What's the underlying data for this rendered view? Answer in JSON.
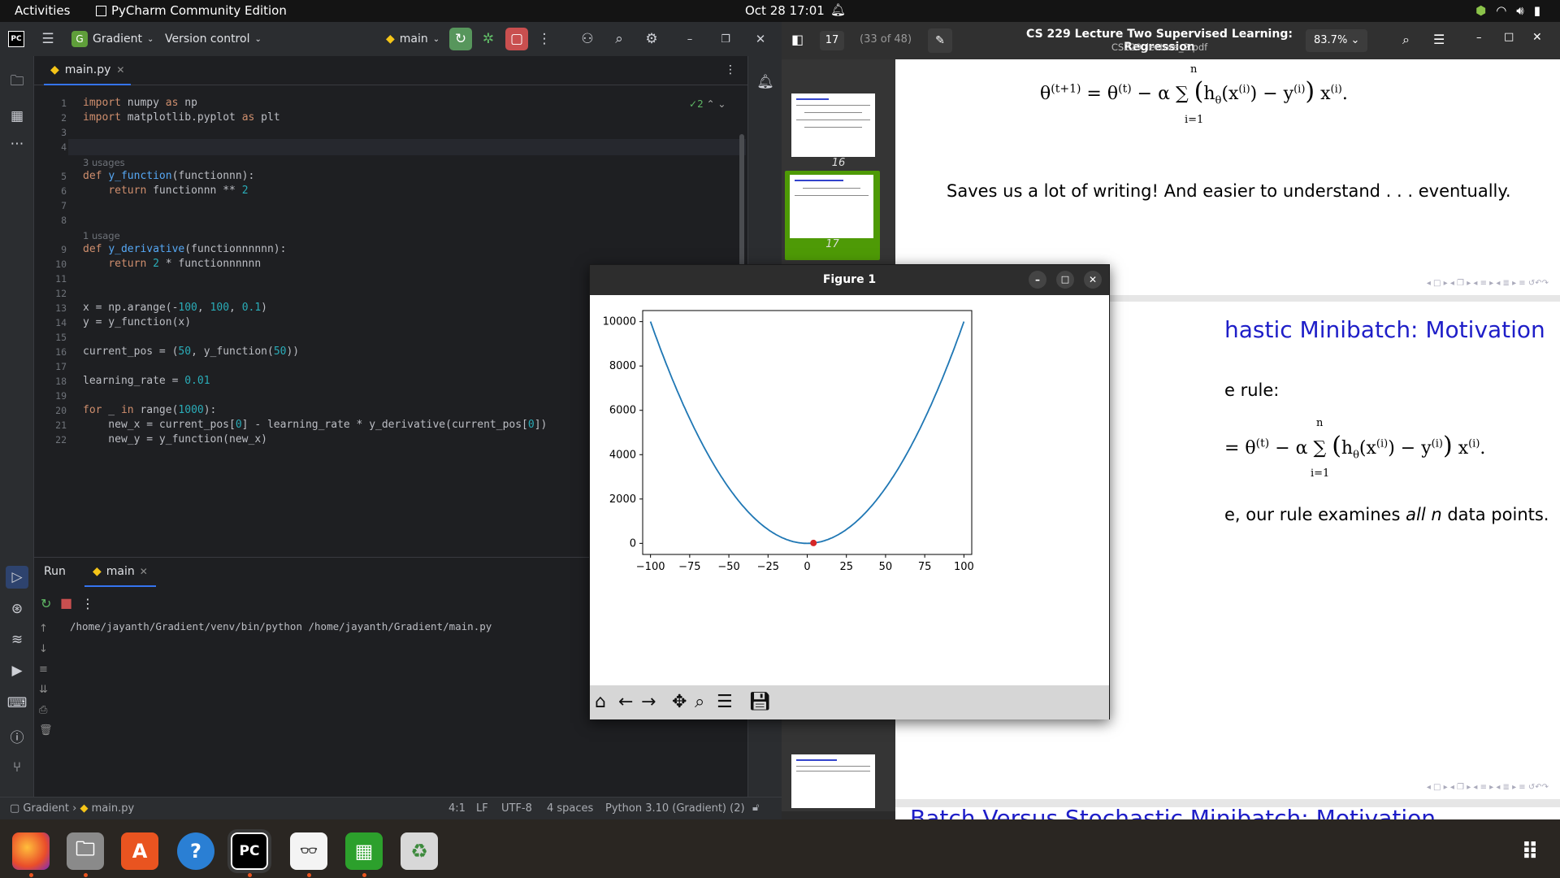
{
  "system": {
    "activities": "Activities",
    "app_name": "PyCharm Community Edition",
    "clock": "Oct 28  17:01"
  },
  "pycharm": {
    "project_initial": "G",
    "project": "Gradient",
    "vcs": "Version control",
    "branch": "main",
    "file_tab": "main.py",
    "inspections": "2",
    "code_lines": [
      {
        "n": "1",
        "html": "<span class='kw'>import</span> numpy <span class='kw'>as</span> np"
      },
      {
        "n": "2",
        "html": "<span class='kw'>import</span> matplotlib.pyplot <span class='kw'>as</span> plt"
      },
      {
        "n": "3",
        "html": ""
      },
      {
        "n": "4",
        "html": ""
      },
      {
        "hint": "3 usages"
      },
      {
        "n": "5",
        "html": "<span class='kw'>def</span> <span class='fn'>y_function</span>(functionnn):"
      },
      {
        "n": "6",
        "html": "    <span class='kw'>return</span> functionnn ** <span class='num'>2</span>"
      },
      {
        "n": "7",
        "html": ""
      },
      {
        "n": "8",
        "html": ""
      },
      {
        "hint": "1 usage"
      },
      {
        "n": "9",
        "html": "<span class='kw'>def</span> <span class='fn'>y_derivative</span>(functionnnnnn):"
      },
      {
        "n": "10",
        "html": "    <span class='kw'>return</span> <span class='num'>2</span> * functionnnnnn"
      },
      {
        "n": "11",
        "html": ""
      },
      {
        "n": "12",
        "html": ""
      },
      {
        "n": "13",
        "html": "x = np.arange(-<span class='num'>100</span>, <span class='num'>100</span>, <span class='num'>0.1</span>)"
      },
      {
        "n": "14",
        "html": "y = y_function(x)"
      },
      {
        "n": "15",
        "html": ""
      },
      {
        "n": "16",
        "html": "current_pos = (<span class='num'>50</span>, y_function(<span class='num'>50</span>))"
      },
      {
        "n": "17",
        "html": ""
      },
      {
        "n": "18",
        "html": "learning_rate = <span class='num'>0.01</span>"
      },
      {
        "n": "19",
        "html": ""
      },
      {
        "n": "20",
        "html": "<span class='kw'>for</span> _ <span class='kw'>in</span> range(<span class='num'>1000</span>):"
      },
      {
        "n": "21",
        "html": "    new_x = current_pos[<span class='num'>0</span>] - learning_rate * y_derivative(current_pos[<span class='num'>0</span>])"
      },
      {
        "n": "22",
        "html": "    new_y = y_function(new_x)"
      }
    ],
    "run_tab": "Run",
    "run_config": "main",
    "run_output": "/home/jayanth/Gradient/venv/bin/python /home/jayanth/Gradient/main.py",
    "status": {
      "project": "Gradient",
      "file": "main.py",
      "position": "4:1",
      "line_sep": "LF",
      "encoding": "UTF-8",
      "indent": "4 spaces",
      "interpreter": "Python 3.10 (Gradient) (2)"
    }
  },
  "pdf": {
    "page_num": "17",
    "page_of": "(33 of 48)",
    "title": "CS 229 Lecture Two  Supervised Learning: Regression",
    "filename": "CS229_lecture_2.pdf",
    "zoom": "83.7%",
    "thumb_labels": [
      "16",
      "17"
    ],
    "page1_text": "Saves us a lot of writing! And easier to understand . . . eventually.",
    "slide2_title": "hastic Minibatch: Motivation",
    "slide2_rule": "e rule:",
    "slide2_text": "e, our rule examines all n data points.",
    "slide3_title": "Batch Versus Stochastic Minibatch: Motivation"
  },
  "figure": {
    "title": "Figure 1",
    "curve_color": "#1f77b4",
    "point_color": "#d62728"
  },
  "chart_data": {
    "type": "line",
    "title": "",
    "xlabel": "",
    "ylabel": "",
    "xlim": [
      -105,
      105
    ],
    "ylim": [
      -500,
      10500
    ],
    "xticks": [
      -100,
      -75,
      -50,
      -25,
      0,
      25,
      50,
      75,
      100
    ],
    "yticks": [
      0,
      2000,
      4000,
      6000,
      8000,
      10000
    ],
    "series": [
      {
        "x": [
          -100,
          -75,
          -50,
          -25,
          0,
          25,
          50,
          75,
          100
        ],
        "values": [
          10000,
          5625,
          2500,
          625,
          0,
          625,
          2500,
          5625,
          10000
        ]
      }
    ],
    "points": [
      {
        "x": 4,
        "y": 16
      }
    ]
  }
}
